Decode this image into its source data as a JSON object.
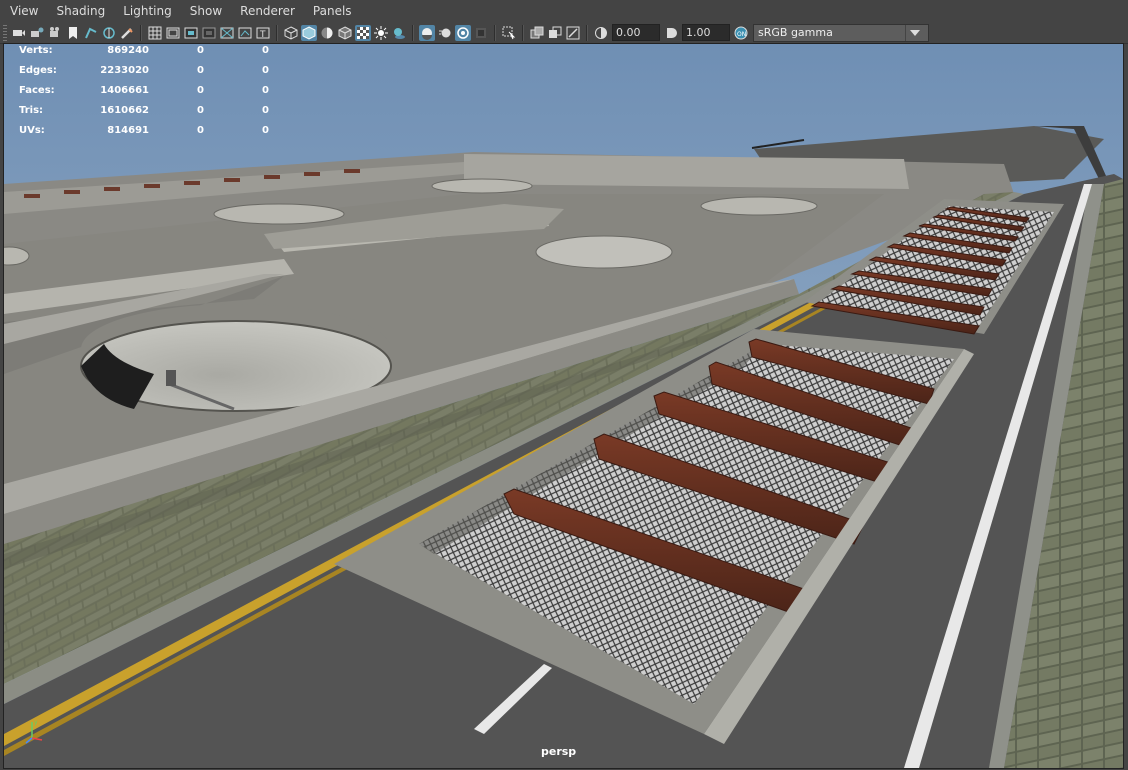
{
  "menu": [
    "View",
    "Shading",
    "Lighting",
    "Show",
    "Renderer",
    "Panels"
  ],
  "toolbar": {
    "exposure_value": "0.00",
    "gamma_value": "1.00",
    "color_space": "sRGB gamma",
    "icons": [
      "camera-select-icon",
      "camera-attributes-icon",
      "bookmarks-icon",
      "image-plane-icon",
      "2d-pan-zoom-icon",
      "grease-pencil-icon",
      "grid-icon",
      "film-gate-icon",
      "resolution-gate-icon",
      "gate-mask-icon",
      "field-chart-icon",
      "safe-action-icon",
      "safe-title-icon",
      "wireframe-icon",
      "smooth-shade-icon",
      "default-material-icon",
      "wireframe-on-shaded-icon",
      "textured-icon",
      "use-all-lights-icon",
      "shadows-icon",
      "screen-space-ao-icon",
      "motion-blur-icon",
      "anti-aliasing-icon",
      "depth-of-field-icon",
      "isolate-select-icon",
      "xray-icon",
      "xray-joints-icon",
      "backface-culling-icon",
      "exposure-icon",
      "gamma-icon",
      "color-management-icon"
    ],
    "colors": {
      "bg": "#444444",
      "active": "#5285a6",
      "field": "#2b2b2b"
    }
  },
  "hud": [
    {
      "label": "Verts:",
      "v1": "869240",
      "v2": "0",
      "v3": "0"
    },
    {
      "label": "Edges:",
      "v1": "2233020",
      "v2": "0",
      "v3": "0"
    },
    {
      "label": "Faces:",
      "v1": "1406661",
      "v2": "0",
      "v3": "0"
    },
    {
      "label": "Tris:",
      "v1": "1610662",
      "v2": "0",
      "v3": "0"
    },
    {
      "label": "UVs:",
      "v1": "814691",
      "v2": "0",
      "v3": "0"
    }
  ],
  "viewport": {
    "camera": "persp",
    "sky_top": "#6f8fb4",
    "sky_bottom": "#a9bccf"
  }
}
